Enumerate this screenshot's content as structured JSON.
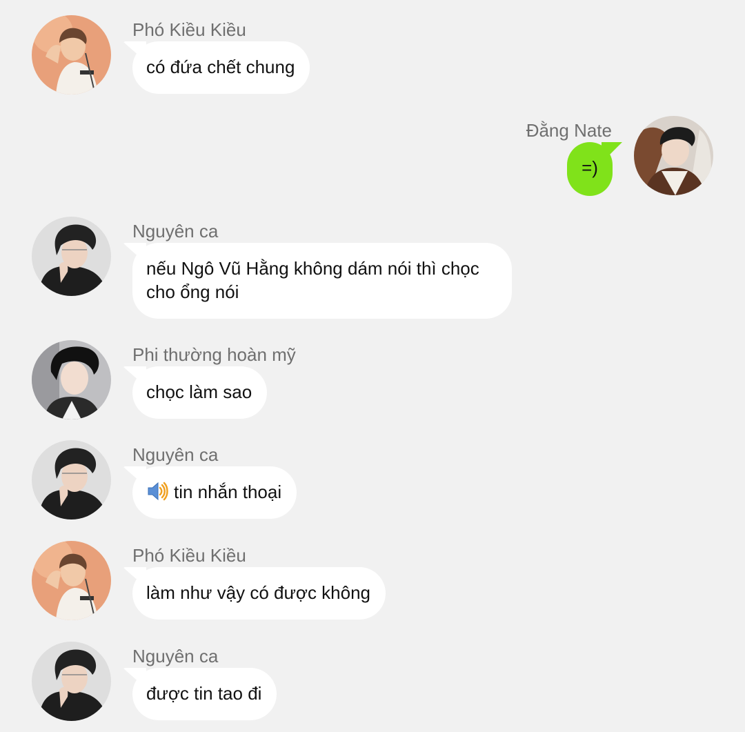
{
  "colors": {
    "background": "#f1f1f1",
    "bubble_incoming": "#ffffff",
    "bubble_outgoing": "#80e21a",
    "sender_name": "#6f6f6f",
    "text": "#111111"
  },
  "messages": [
    {
      "sender": "Phó Kiều Kiều",
      "text": "có đứa chết chung",
      "avatar": "avatar-pho-kieu-kieu",
      "side": "left"
    },
    {
      "sender": "Đằng Nate",
      "text": "=)",
      "avatar": "avatar-dang-nate",
      "side": "right"
    },
    {
      "sender": "Nguyên ca",
      "text": "nếu Ngô Vũ Hằng không dám nói thì chọc cho ổng nói",
      "avatar": "avatar-nguyen-ca",
      "side": "left"
    },
    {
      "sender": "Phi thường hoàn mỹ",
      "text": "chọc làm sao",
      "avatar": "avatar-phi-thuong-hoan-my",
      "side": "left"
    },
    {
      "sender": "Nguyên ca",
      "text": "tin nhắn thoại",
      "icon": "speaker-icon",
      "avatar": "avatar-nguyen-ca",
      "side": "left"
    },
    {
      "sender": "Phó Kiều Kiều",
      "text": "làm như vậy có được không",
      "avatar": "avatar-pho-kieu-kieu",
      "side": "left"
    },
    {
      "sender": "Nguyên ca",
      "text": "được tin tao đi",
      "avatar": "avatar-nguyen-ca",
      "side": "left"
    }
  ]
}
